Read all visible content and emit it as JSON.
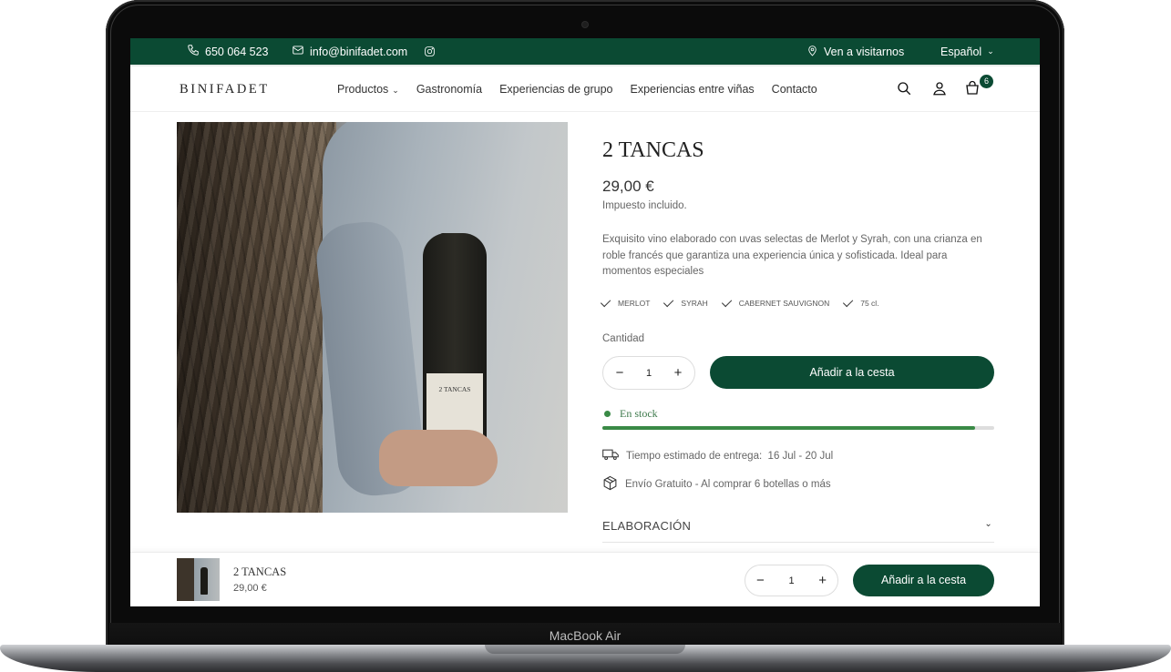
{
  "device": {
    "label": "MacBook Air"
  },
  "topbar": {
    "phone": "650 064 523",
    "email": "info@binifadet.com",
    "visit": "Ven a visitarnos",
    "language": "Español"
  },
  "nav": {
    "logo": "BINIFADET",
    "menu": [
      {
        "label": "Productos"
      },
      {
        "label": "Gastronomía"
      },
      {
        "label": "Experiencias de grupo"
      },
      {
        "label": "Experiencias entre viñas"
      },
      {
        "label": "Contacto"
      }
    ],
    "cart_count": "6"
  },
  "product": {
    "bottle_label": "2 TANCAS",
    "title": "2 TANCAS",
    "price": "29,00 €",
    "tax_note": "Impuesto incluido.",
    "description": "Exquisito vino elaborado con uvas selectas de Merlot y Syrah, con una crianza en roble francés que garantiza una experiencia única y sofisticada. Ideal para momentos especiales",
    "tags": [
      "MERLOT",
      "SYRAH",
      "CABERNET SAUVIGNON",
      "75 cl."
    ],
    "quantity_label": "Cantidad",
    "quantity": "1",
    "minus": "−",
    "plus": "+",
    "add_to_cart": "Añadir a la cesta",
    "stock_text": "En stock",
    "stock_level": 0.95,
    "delivery": "Tiempo estimado de entrega:  16 Jul - 20 Jul",
    "shipping": "Envío Gratuito - Al comprar 6 botellas o más",
    "accordion_title": "ELABORACIÓN"
  },
  "sticky": {
    "title": "2 TANCAS",
    "price": "29,00 €",
    "quantity": "1",
    "minus": "−",
    "plus": "+",
    "add_to_cart": "Añadir a la cesta"
  },
  "colors": {
    "brand": "#0b4a33",
    "stock": "#3a8a46"
  }
}
